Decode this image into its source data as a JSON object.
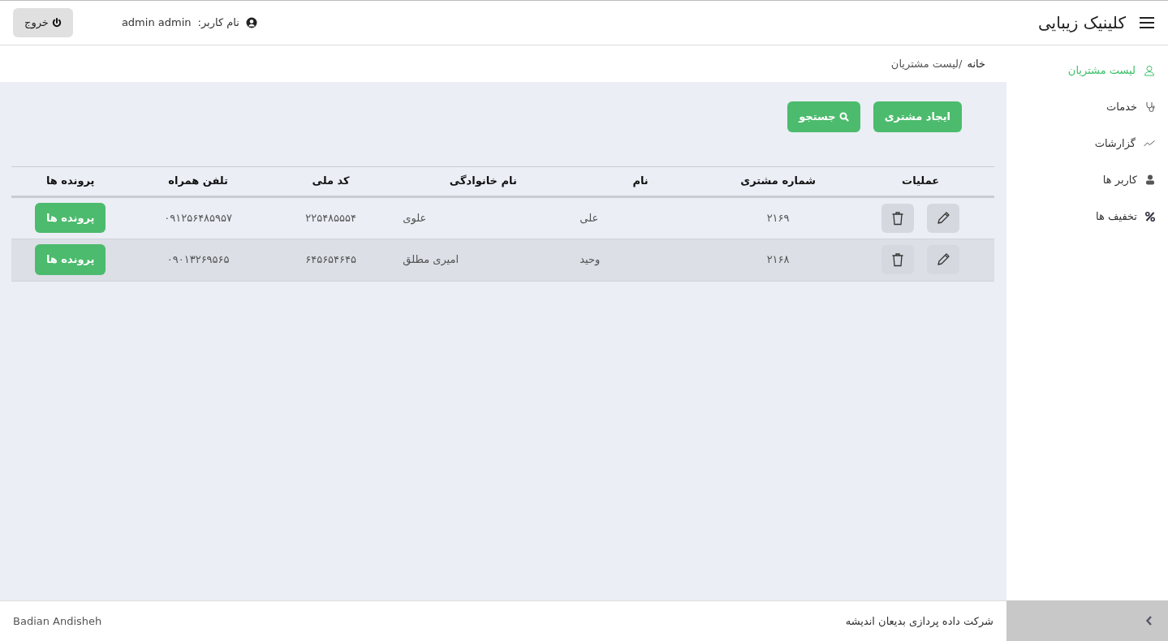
{
  "header": {
    "title": "کلینیک زیبایی",
    "user_label": "نام کاربر:",
    "user_name": "admin admin",
    "logout": "خروج"
  },
  "breadcrumb": [
    "خانه",
    "/لیست مشتریان"
  ],
  "sidebar": {
    "items": [
      {
        "label": "لیست مشتریان",
        "selected": true
      },
      {
        "label": "خدمات",
        "selected": false
      },
      {
        "label": "گزارشات",
        "selected": false
      },
      {
        "label": "کاربر ها",
        "selected": false
      },
      {
        "label": "تخفیف ها",
        "selected": false
      }
    ]
  },
  "actions": {
    "create": "ایجاد مشتری",
    "search": "جستجو"
  },
  "table": {
    "columns": [
      "عملیات",
      "شماره مشتری",
      "نام",
      "نام خانوادگی",
      "کد ملی",
      "تلفن همراه",
      "پرونده ها"
    ],
    "rows": [
      {
        "number": "۲۱۶۹",
        "first_name": "علی",
        "last_name": "علوی",
        "national_code": "۲۲۵۴۸۵۵۵۴",
        "mobile": "۰۹۱۲۵۶۴۸۵۹۵۷",
        "files": "پرونده ها"
      },
      {
        "number": "۲۱۶۸",
        "first_name": "وحید",
        "last_name": "امیری مطلق",
        "national_code": "۶۴۵۶۵۴۶۴۵",
        "mobile": "۰۹۰۱۳۲۶۹۵۶۵",
        "files": "پرونده ها"
      }
    ]
  },
  "footer": {
    "company": "شرکت داده پردازی بدیعان اندیشه",
    "brand": "Badian Andisheh"
  }
}
